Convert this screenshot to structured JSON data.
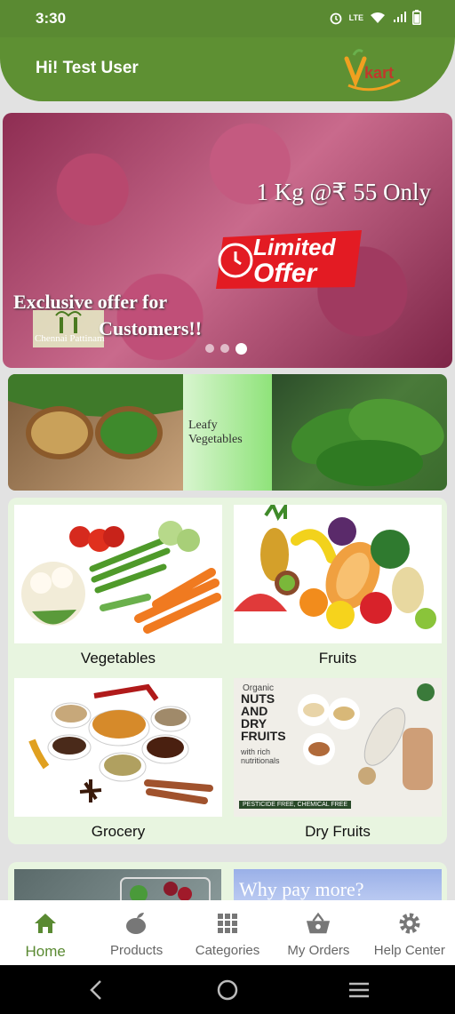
{
  "status_bar": {
    "time": "3:30",
    "lte_label": "LTE"
  },
  "header": {
    "greeting": "Hi! Test User",
    "logo_text": "Vkart"
  },
  "banner": {
    "price_text": "1 Kg @₹ 55 Only",
    "offer_line1": "Limited",
    "offer_line2": "Offer",
    "line1": "Exclusive offer for",
    "logo_text": "Chennai Pattinam",
    "line2": "Customers!!",
    "slides": 3,
    "active_slide": 3
  },
  "leafy_banner": {
    "label": "Leafy Vegetables"
  },
  "categories": [
    {
      "label": "Vegetables"
    },
    {
      "label": "Fruits"
    },
    {
      "label": "Grocery"
    },
    {
      "label": "Dry Fruits"
    }
  ],
  "dry_fruits_image": {
    "line1": "Organic",
    "line2": "NUTS",
    "line3": "AND",
    "line4": "DRY",
    "line5": "FRUITS",
    "line6": "with rich",
    "line7": "nutritionals",
    "footer": "PESTICIDE FREE, CHEMICAL FREE"
  },
  "promo": {
    "text": "Why pay more?"
  },
  "bottom_nav": [
    {
      "label": "Home",
      "icon": "home-icon"
    },
    {
      "label": "Products",
      "icon": "products-icon"
    },
    {
      "label": "Categories",
      "icon": "grid-icon"
    },
    {
      "label": "My Orders",
      "icon": "basket-icon"
    },
    {
      "label": "Help Center",
      "icon": "gear-icon"
    }
  ],
  "colors": {
    "primary": "#5a8a32",
    "card_bg": "#e8f5e0"
  }
}
